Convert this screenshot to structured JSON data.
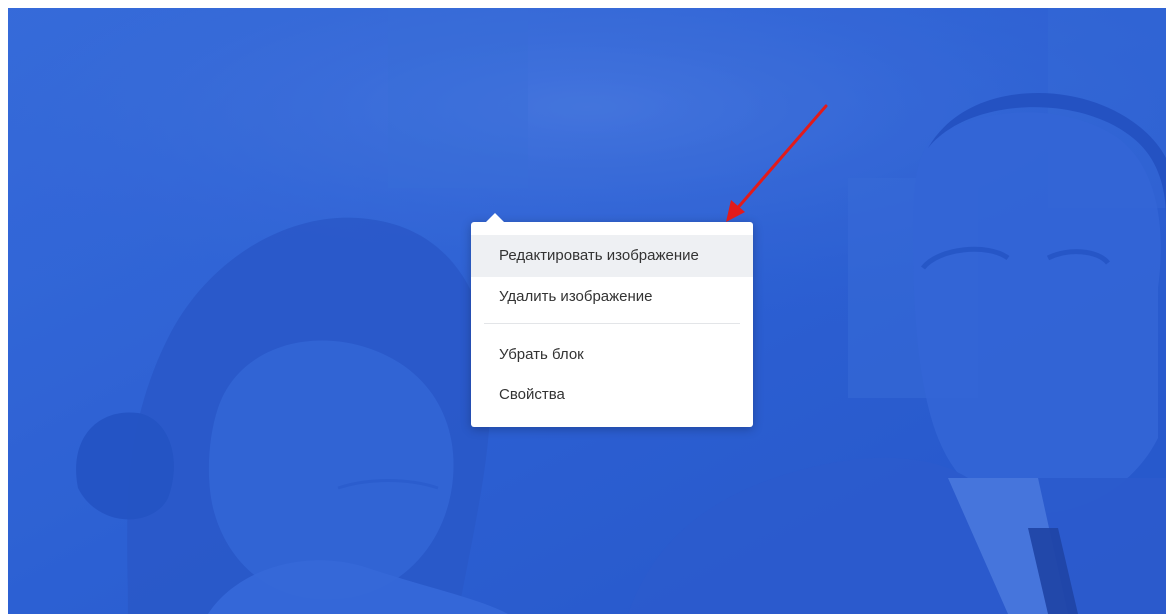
{
  "context_menu": {
    "items": [
      {
        "label": "Редактировать изображение",
        "active": true
      },
      {
        "label": "Удалить изображение",
        "active": false
      },
      {
        "label": "Убрать блок",
        "active": false
      },
      {
        "label": "Свойства",
        "active": false
      }
    ]
  },
  "colors": {
    "overlay_blue": "#2f62d4",
    "menu_background": "#ffffff",
    "menu_hover": "#eef0f3",
    "menu_text": "#333333",
    "arrow_red": "#e21b1b"
  },
  "annotation": {
    "icon": "red-arrow-icon"
  }
}
